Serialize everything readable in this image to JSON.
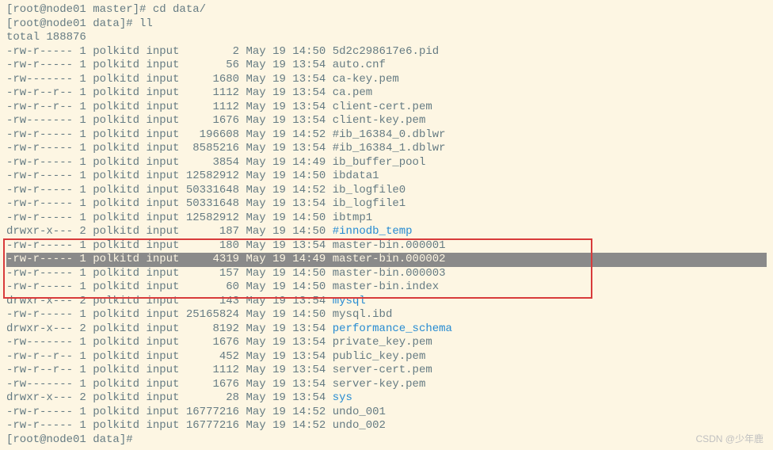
{
  "prompt1": "[root@node01 master]# cd data/",
  "prompt2": "[root@node01 data]# ll",
  "total": "total 188876",
  "prompt3": "[root@node01 data]#",
  "watermark": "CSDN @少年鹿",
  "rows": [
    {
      "perm": "-rw-r-----",
      "links": "1",
      "owner": "polkitd",
      "group": "input",
      "size": "2",
      "mon": "May",
      "day": "19",
      "time": "14:50",
      "name": "5d2c298617e6.pid",
      "cls": "file"
    },
    {
      "perm": "-rw-r-----",
      "links": "1",
      "owner": "polkitd",
      "group": "input",
      "size": "56",
      "mon": "May",
      "day": "19",
      "time": "13:54",
      "name": "auto.cnf",
      "cls": "file"
    },
    {
      "perm": "-rw-------",
      "links": "1",
      "owner": "polkitd",
      "group": "input",
      "size": "1680",
      "mon": "May",
      "day": "19",
      "time": "13:54",
      "name": "ca-key.pem",
      "cls": "file"
    },
    {
      "perm": "-rw-r--r--",
      "links": "1",
      "owner": "polkitd",
      "group": "input",
      "size": "1112",
      "mon": "May",
      "day": "19",
      "time": "13:54",
      "name": "ca.pem",
      "cls": "file"
    },
    {
      "perm": "-rw-r--r--",
      "links": "1",
      "owner": "polkitd",
      "group": "input",
      "size": "1112",
      "mon": "May",
      "day": "19",
      "time": "13:54",
      "name": "client-cert.pem",
      "cls": "file"
    },
    {
      "perm": "-rw-------",
      "links": "1",
      "owner": "polkitd",
      "group": "input",
      "size": "1676",
      "mon": "May",
      "day": "19",
      "time": "13:54",
      "name": "client-key.pem",
      "cls": "file"
    },
    {
      "perm": "-rw-r-----",
      "links": "1",
      "owner": "polkitd",
      "group": "input",
      "size": "196608",
      "mon": "May",
      "day": "19",
      "time": "14:52",
      "name": "#ib_16384_0.dblwr",
      "cls": "file"
    },
    {
      "perm": "-rw-r-----",
      "links": "1",
      "owner": "polkitd",
      "group": "input",
      "size": "8585216",
      "mon": "May",
      "day": "19",
      "time": "13:54",
      "name": "#ib_16384_1.dblwr",
      "cls": "file"
    },
    {
      "perm": "-rw-r-----",
      "links": "1",
      "owner": "polkitd",
      "group": "input",
      "size": "3854",
      "mon": "May",
      "day": "19",
      "time": "14:49",
      "name": "ib_buffer_pool",
      "cls": "file"
    },
    {
      "perm": "-rw-r-----",
      "links": "1",
      "owner": "polkitd",
      "group": "input",
      "size": "12582912",
      "mon": "May",
      "day": "19",
      "time": "14:50",
      "name": "ibdata1",
      "cls": "file"
    },
    {
      "perm": "-rw-r-----",
      "links": "1",
      "owner": "polkitd",
      "group": "input",
      "size": "50331648",
      "mon": "May",
      "day": "19",
      "time": "14:52",
      "name": "ib_logfile0",
      "cls": "file"
    },
    {
      "perm": "-rw-r-----",
      "links": "1",
      "owner": "polkitd",
      "group": "input",
      "size": "50331648",
      "mon": "May",
      "day": "19",
      "time": "13:54",
      "name": "ib_logfile1",
      "cls": "file"
    },
    {
      "perm": "-rw-r-----",
      "links": "1",
      "owner": "polkitd",
      "group": "input",
      "size": "12582912",
      "mon": "May",
      "day": "19",
      "time": "14:50",
      "name": "ibtmp1",
      "cls": "file"
    },
    {
      "perm": "drwxr-x---",
      "links": "2",
      "owner": "polkitd",
      "group": "input",
      "size": "187",
      "mon": "May",
      "day": "19",
      "time": "14:50",
      "name": "#innodb_temp",
      "cls": "dirfile"
    },
    {
      "perm": "-rw-r-----",
      "links": "1",
      "owner": "polkitd",
      "group": "input",
      "size": "180",
      "mon": "May",
      "day": "19",
      "time": "13:54",
      "name": "master-bin.000001",
      "cls": "file",
      "flags": "boxed"
    },
    {
      "perm": "-rw-r-----",
      "links": "1",
      "owner": "polkitd",
      "group": "input",
      "size": "4319",
      "mon": "May",
      "day": "19",
      "time": "14:49",
      "name": "master-bin.000002",
      "cls": "file",
      "flags": "boxed highlight"
    },
    {
      "perm": "-rw-r-----",
      "links": "1",
      "owner": "polkitd",
      "group": "input",
      "size": "157",
      "mon": "May",
      "day": "19",
      "time": "14:50",
      "name": "master-bin.000003",
      "cls": "file",
      "flags": "boxed"
    },
    {
      "perm": "-rw-r-----",
      "links": "1",
      "owner": "polkitd",
      "group": "input",
      "size": "60",
      "mon": "May",
      "day": "19",
      "time": "14:50",
      "name": "master-bin.index",
      "cls": "file",
      "flags": "boxed"
    },
    {
      "perm": "drwxr-x---",
      "links": "2",
      "owner": "polkitd",
      "group": "input",
      "size": "143",
      "mon": "May",
      "day": "19",
      "time": "13:54",
      "name": "mysql",
      "cls": "dirfile"
    },
    {
      "perm": "-rw-r-----",
      "links": "1",
      "owner": "polkitd",
      "group": "input",
      "size": "25165824",
      "mon": "May",
      "day": "19",
      "time": "14:50",
      "name": "mysql.ibd",
      "cls": "file"
    },
    {
      "perm": "drwxr-x---",
      "links": "2",
      "owner": "polkitd",
      "group": "input",
      "size": "8192",
      "mon": "May",
      "day": "19",
      "time": "13:54",
      "name": "performance_schema",
      "cls": "dirfile"
    },
    {
      "perm": "-rw-------",
      "links": "1",
      "owner": "polkitd",
      "group": "input",
      "size": "1676",
      "mon": "May",
      "day": "19",
      "time": "13:54",
      "name": "private_key.pem",
      "cls": "file"
    },
    {
      "perm": "-rw-r--r--",
      "links": "1",
      "owner": "polkitd",
      "group": "input",
      "size": "452",
      "mon": "May",
      "day": "19",
      "time": "13:54",
      "name": "public_key.pem",
      "cls": "file"
    },
    {
      "perm": "-rw-r--r--",
      "links": "1",
      "owner": "polkitd",
      "group": "input",
      "size": "1112",
      "mon": "May",
      "day": "19",
      "time": "13:54",
      "name": "server-cert.pem",
      "cls": "file"
    },
    {
      "perm": "-rw-------",
      "links": "1",
      "owner": "polkitd",
      "group": "input",
      "size": "1676",
      "mon": "May",
      "day": "19",
      "time": "13:54",
      "name": "server-key.pem",
      "cls": "file"
    },
    {
      "perm": "drwxr-x---",
      "links": "2",
      "owner": "polkitd",
      "group": "input",
      "size": "28",
      "mon": "May",
      "day": "19",
      "time": "13:54",
      "name": "sys",
      "cls": "dirfile"
    },
    {
      "perm": "-rw-r-----",
      "links": "1",
      "owner": "polkitd",
      "group": "input",
      "size": "16777216",
      "mon": "May",
      "day": "19",
      "time": "14:52",
      "name": "undo_001",
      "cls": "file"
    },
    {
      "perm": "-rw-r-----",
      "links": "1",
      "owner": "polkitd",
      "group": "input",
      "size": "16777216",
      "mon": "May",
      "day": "19",
      "time": "14:52",
      "name": "undo_002",
      "cls": "file"
    }
  ]
}
